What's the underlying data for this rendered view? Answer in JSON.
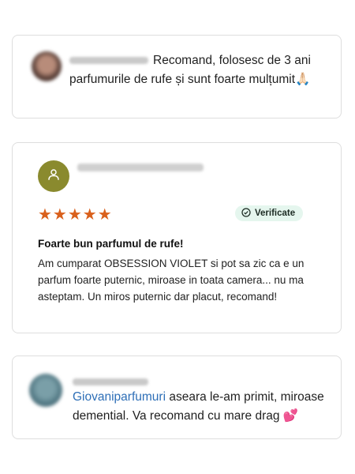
{
  "reviews": [
    {
      "text": "Recomand, folosesc de 3 ani parfumurile de rufe și sunt foarte mulțumit",
      "emoji": "🙏🏻"
    },
    {
      "stars": "★★★★★",
      "rating": 5,
      "badge": "Verificate",
      "title": "Foarte bun parfumul de rufe!",
      "body": "Am cumparat OBSESSION VIOLET si pot sa zic ca e un parfum foarte puternic, miroase in toata camera... nu ma asteptam. Un miros puternic dar placut, recomand!"
    },
    {
      "mention": "Giovaniparfumuri",
      "text": " aseara le-am primit, miroase demential. Va recomand cu mare drag ",
      "emoji": "💕"
    }
  ],
  "colors": {
    "star": "#d9601c",
    "badge_bg": "#e5f6ee",
    "avatar2": "#8a8a2e",
    "mention": "#2e6fb7",
    "card_border": "#dedede"
  }
}
